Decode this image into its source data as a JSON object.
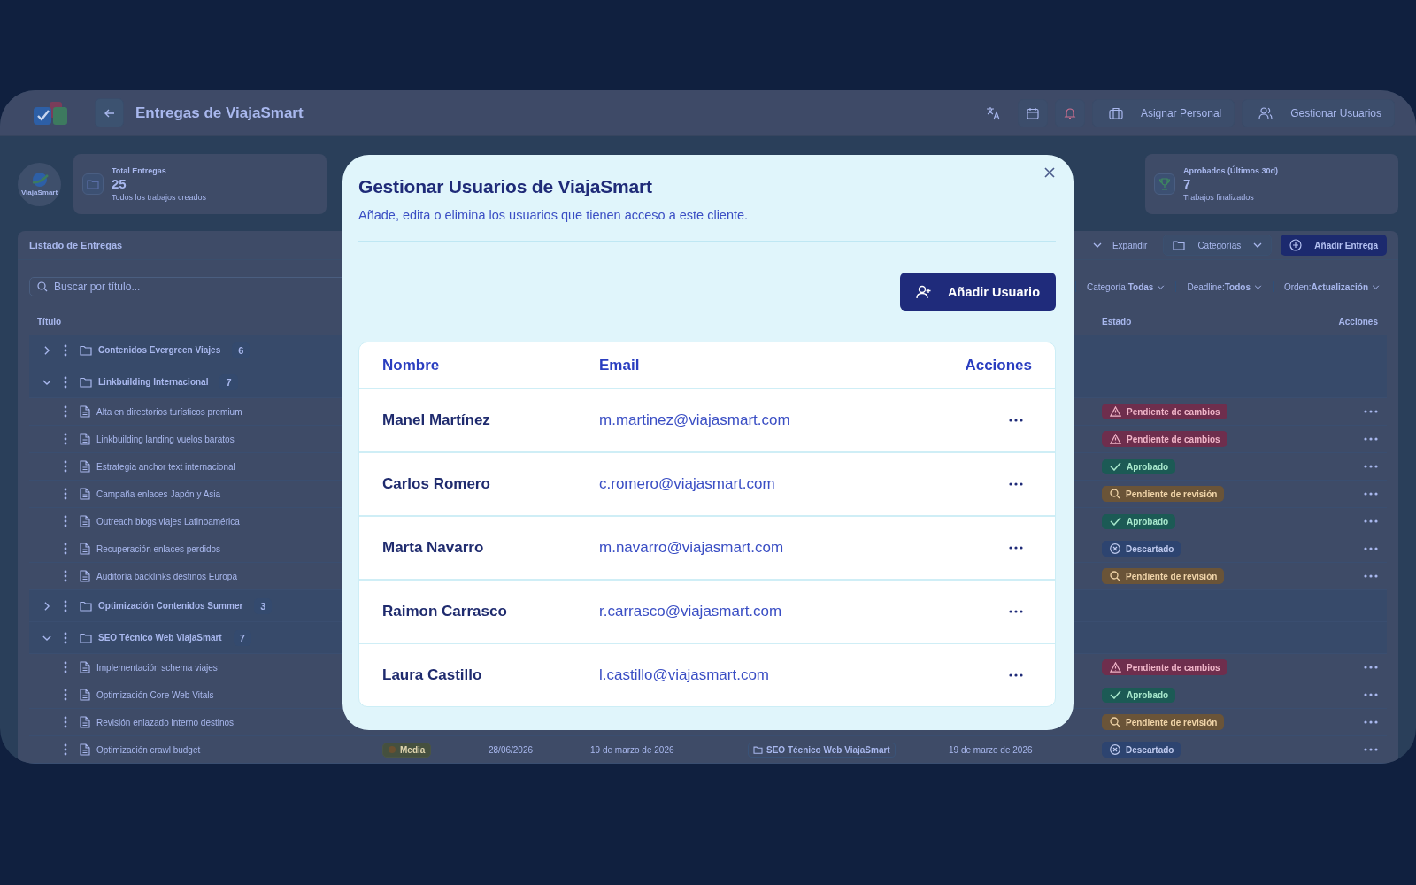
{
  "header": {
    "title": "Entregas de ViajaSmart",
    "buttons": [
      {
        "label": "Asignar Personal",
        "kind": "staff"
      },
      {
        "label": "Gestionar Usuarios",
        "kind": "users"
      }
    ]
  },
  "client_logo": {
    "label": "ViajaSmart"
  },
  "stats": [
    {
      "label": "Total Entregas",
      "value": "25",
      "caption": "Todos los trabajos creados",
      "kind": "folder"
    },
    {
      "label": "Aprobados (Últimos 30d)",
      "value": "7",
      "caption": "Trabajos finalizados",
      "kind": "trophy"
    }
  ],
  "list": {
    "title": "Listado de Entregas",
    "expand_label": "Expandir",
    "categories_label": "Categorías",
    "add_label": "Añadir Entrega",
    "search": {
      "placeholder": "Buscar por título..."
    },
    "filters": [
      {
        "label": "Categoría:",
        "value": "Todas"
      },
      {
        "label": "Deadline:",
        "value": "Todos"
      },
      {
        "label": "Orden:",
        "value": "Actualización"
      }
    ],
    "columns": {
      "title": "Título",
      "status": "Estado",
      "actions": "Acciones"
    },
    "groups": [
      {
        "name": "Contenidos Evergreen Viajes",
        "count": "6",
        "expanded": false
      },
      {
        "name": "Linkbuilding Internacional",
        "count": "7",
        "expanded": true,
        "children": [
          {
            "title": "Alta en directorios turísticos premium",
            "status": {
              "label": "Pendiente de cambios",
              "kind": "changes"
            }
          },
          {
            "title": "Linkbuilding landing vuelos baratos",
            "status": {
              "label": "Pendiente de cambios",
              "kind": "changes"
            }
          },
          {
            "title": "Estrategia anchor text internacional",
            "status": {
              "label": "Aprobado",
              "kind": "approved"
            }
          },
          {
            "title": "Campaña enlaces Japón y Asia",
            "status": {
              "label": "Pendiente de revisión",
              "kind": "review"
            }
          },
          {
            "title": "Outreach blogs viajes Latinoamérica",
            "status": {
              "label": "Aprobado",
              "kind": "approved"
            }
          },
          {
            "title": "Recuperación enlaces perdidos",
            "status": {
              "label": "Descartado",
              "kind": "discarded"
            }
          },
          {
            "title": "Auditoría backlinks destinos Europa",
            "status": {
              "label": "Pendiente de revisión",
              "kind": "review"
            }
          }
        ]
      },
      {
        "name": "Optimización Contenidos Summer",
        "count": "3",
        "expanded": false
      },
      {
        "name": "SEO Técnico Web ViajaSmart",
        "count": "7",
        "expanded": true,
        "children": [
          {
            "title": "Implementación schema viajes",
            "status": {
              "label": "Pendiente de cambios",
              "kind": "changes"
            }
          },
          {
            "title": "Optimización Core Web Vitals",
            "status": {
              "label": "Aprobado",
              "kind": "approved"
            }
          },
          {
            "title": "Revisión enlazado interno destinos",
            "status": {
              "label": "Pendiente de revisión",
              "kind": "review"
            }
          },
          {
            "title": "Optimización crawl budget",
            "priority": "Media",
            "deadline": "28/06/2026",
            "created": "19 de marzo de 2026",
            "category": "SEO Técnico Web ViajaSmart",
            "updated": "19 de marzo de 2026",
            "status": {
              "label": "Descartado",
              "kind": "discarded"
            }
          }
        ]
      }
    ]
  },
  "modal": {
    "title": "Gestionar Usuarios de ViajaSmart",
    "subtitle": "Añade, edita o elimina los usuarios que tienen acceso a este cliente.",
    "add_button": "Añadir Usuario",
    "columns": [
      "Nombre",
      "Email",
      "Acciones"
    ],
    "users": [
      {
        "name": "Manel Martínez",
        "email": "m.martinez@viajasmart.com"
      },
      {
        "name": "Carlos Romero",
        "email": "c.romero@viajasmart.com"
      },
      {
        "name": "Marta Navarro",
        "email": "m.navarro@viajasmart.com"
      },
      {
        "name": "Raimon Carrasco",
        "email": "r.carrasco@viajasmart.com"
      },
      {
        "name": "Laura Castillo",
        "email": "l.castillo@viajasmart.com"
      }
    ]
  }
}
